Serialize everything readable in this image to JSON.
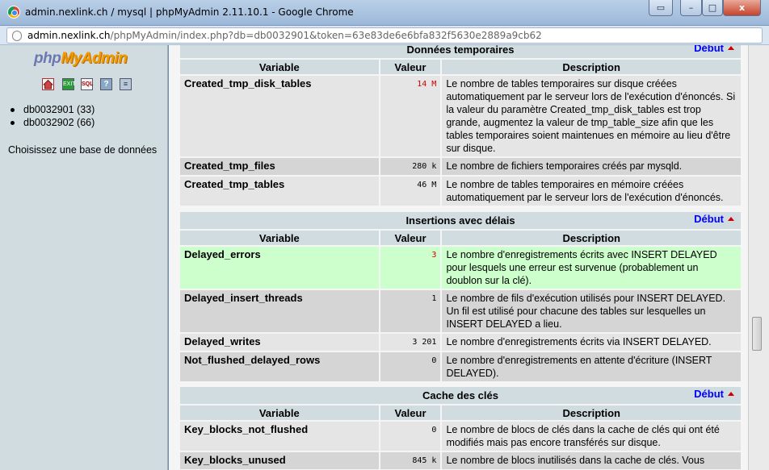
{
  "window": {
    "title": "admin.nexlink.ch / mysql | phpMyAdmin 2.11.10.1 - Google Chrome",
    "controls": {
      "minimize": "–",
      "maximize": "□",
      "close": "x",
      "extra": "▭"
    }
  },
  "address": {
    "host": "admin.nexlink.ch",
    "path": "/phpMyAdmin/index.php?db=db0032901&token=63e83de6e6bfa832f5630e2889a9cb62"
  },
  "sidebar": {
    "logo_php": "php",
    "logo_my": "MyAdmin",
    "icons": [
      "home-icon",
      "exit-icon",
      "sql-icon",
      "help-icon",
      "docs-icon"
    ],
    "databases": [
      {
        "label": "db0032901 (33)"
      },
      {
        "label": "db0032902 (66)"
      }
    ],
    "choose_label": "Choisissez une base de données"
  },
  "headers": {
    "variable": "Variable",
    "value": "Valeur",
    "description": "Description"
  },
  "sections": [
    {
      "title": "Données temporaires",
      "debut": "Début",
      "rows": [
        {
          "name": "Created_tmp_disk_tables",
          "value": "14 M",
          "red": true,
          "desc": "Le nombre de tables temporaires sur disque créées automatiquement par le serveur lors de l'exécution d'énoncés. Si la valeur du paramètre Created_tmp_disk_tables est trop grande, augmentez la valeur de tmp_table_size afin que les tables temporaires soient maintenues en mémoire au lieu d'être sur disque."
        },
        {
          "name": "Created_tmp_files",
          "value": "280 k",
          "desc": "Le nombre de fichiers temporaires créés par mysqld."
        },
        {
          "name": "Created_tmp_tables",
          "value": "46 M",
          "desc": "Le nombre de tables temporaires en mémoire créées automatiquement par le serveur lors de l'exécution d'énoncés."
        }
      ]
    },
    {
      "title": "Insertions avec délais",
      "debut": "Début",
      "rows": [
        {
          "name": "Delayed_errors",
          "value": "3",
          "red": true,
          "highlight": true,
          "desc": "Le nombre d'enregistrements écrits avec INSERT DELAYED pour lesquels une erreur est survenue (probablement un doublon sur la clé)."
        },
        {
          "name": "Delayed_insert_threads",
          "value": "1",
          "desc": "Le nombre de fils d'exécution utilisés pour INSERT DELAYED. Un fil est utilisé pour chacune des tables sur lesquelles un INSERT DELAYED a lieu."
        },
        {
          "name": "Delayed_writes",
          "value": "3 201",
          "desc": "Le nombre d'enregistrements écrits via INSERT DELAYED."
        },
        {
          "name": "Not_flushed_delayed_rows",
          "value": "0",
          "desc": "Le nombre d'enregistrements en attente d'écriture (INSERT DELAYED)."
        }
      ]
    },
    {
      "title": "Cache des clés",
      "debut": "Début",
      "rows": [
        {
          "name": "Key_blocks_not_flushed",
          "value": "0",
          "desc": "Le nombre de blocs de clés dans la cache de clés qui ont été modifiés mais pas encore transférés sur disque."
        },
        {
          "name": "Key_blocks_unused",
          "value": "845 k",
          "desc": "Le nombre de blocs inutilisés dans la cache de clés. Vous"
        }
      ]
    }
  ],
  "colors": {
    "header_bg": "#d0dce0",
    "highlight": "#ccffcc",
    "link": "#0000ff",
    "red_value": "#cc0000"
  }
}
